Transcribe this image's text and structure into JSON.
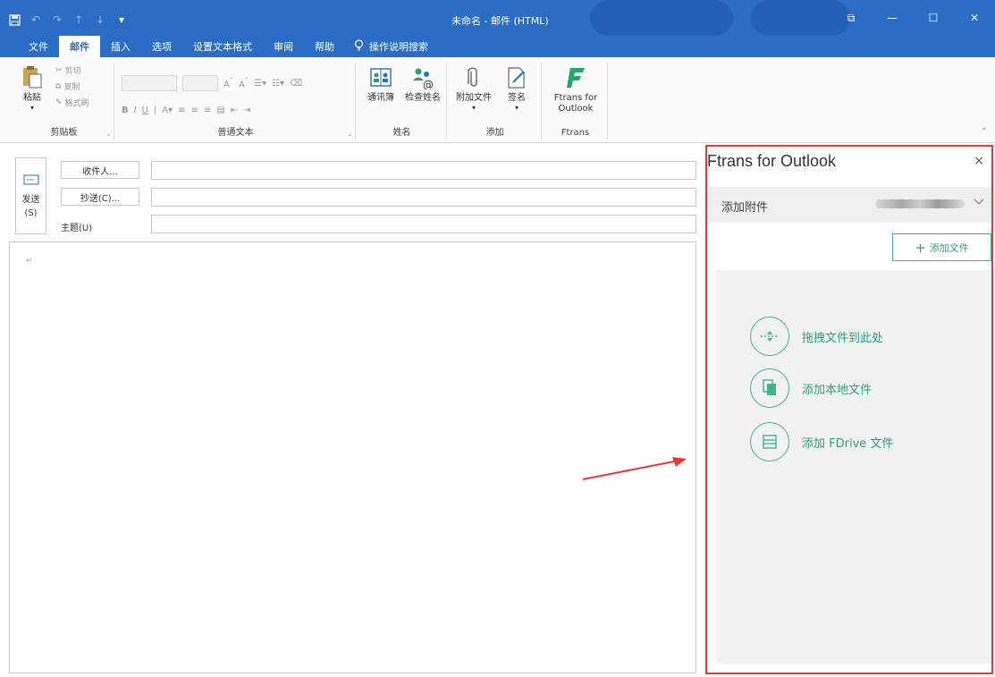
{
  "window": {
    "title": "未命名 - 邮件 (HTML)",
    "controls": [
      "⧉",
      "—",
      "☐",
      "✕"
    ]
  },
  "tabs": [
    {
      "label": "文件",
      "active": false
    },
    {
      "label": "邮件",
      "active": true
    },
    {
      "label": "插入",
      "active": false
    },
    {
      "label": "选项",
      "active": false
    },
    {
      "label": "设置文本格式",
      "active": false
    },
    {
      "label": "审阅",
      "active": false
    },
    {
      "label": "帮助",
      "active": false
    }
  ],
  "tell_me": "操作说明搜索",
  "ribbon": {
    "clipboard": {
      "label": "剪贴板",
      "paste": "粘贴",
      "cut": "剪切",
      "copy": "复制",
      "format_painter": "格式刷"
    },
    "basic_text": {
      "label": "普通文本"
    },
    "names": {
      "label": "姓名",
      "address_book": "通讯簿",
      "check_names": "检查姓名"
    },
    "include": {
      "label": "添加",
      "attach": "附加文件",
      "signature": "签名"
    },
    "ftrans": {
      "label": "Ftrans",
      "button_line1": "Ftrans for",
      "button_line2": "Outlook"
    }
  },
  "compose": {
    "send_line1": "发送",
    "send_line2": "(S)",
    "to": "收件人...",
    "cc": "抄送(C)...",
    "subject": "主题(U)",
    "para_mark": "↵"
  },
  "pane": {
    "title": "Ftrans for Outlook",
    "close": "×",
    "section": "添加附件",
    "add_file": "添加文件",
    "options": [
      {
        "label": "拖拽文件到此处",
        "icon": "drag-drop-icon"
      },
      {
        "label": "添加本地文件",
        "icon": "local-file-icon"
      },
      {
        "label": "添加 FDrive 文件",
        "icon": "fdrive-icon"
      }
    ]
  },
  "colors": {
    "brand": "#2b6cc4",
    "accent_green": "#3fb58a",
    "highlight": "#e53935"
  }
}
